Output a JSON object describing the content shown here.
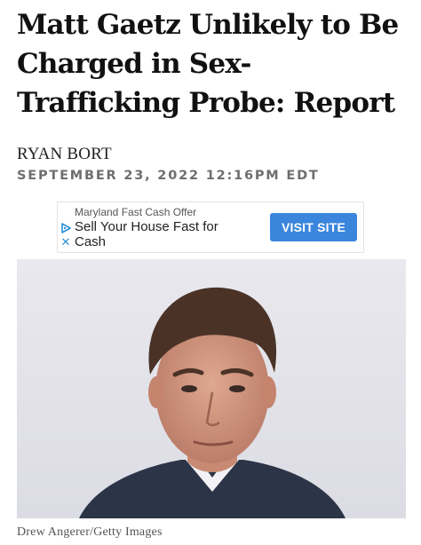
{
  "article": {
    "headline": "Matt Gaetz Unlikely to Be Charged in Sex-Trafficking Probe: Report",
    "author": "RYAN BORT",
    "date": "SEPTEMBER 23, 2022 12:16PM EDT"
  },
  "ad": {
    "advertiser": "Maryland Fast Cash Offer",
    "headline": "Sell Your House Fast for Cash",
    "cta_label": "VISIT SITE",
    "adchoices_icon": "adchoices-triangle-icon",
    "close_icon": "close-x-icon",
    "close_glyph": "✕",
    "cta_color": "#3a86dc"
  },
  "photo": {
    "subject": "man-in-suit-portrait",
    "caption": "Drew Angerer/Getty Images"
  }
}
